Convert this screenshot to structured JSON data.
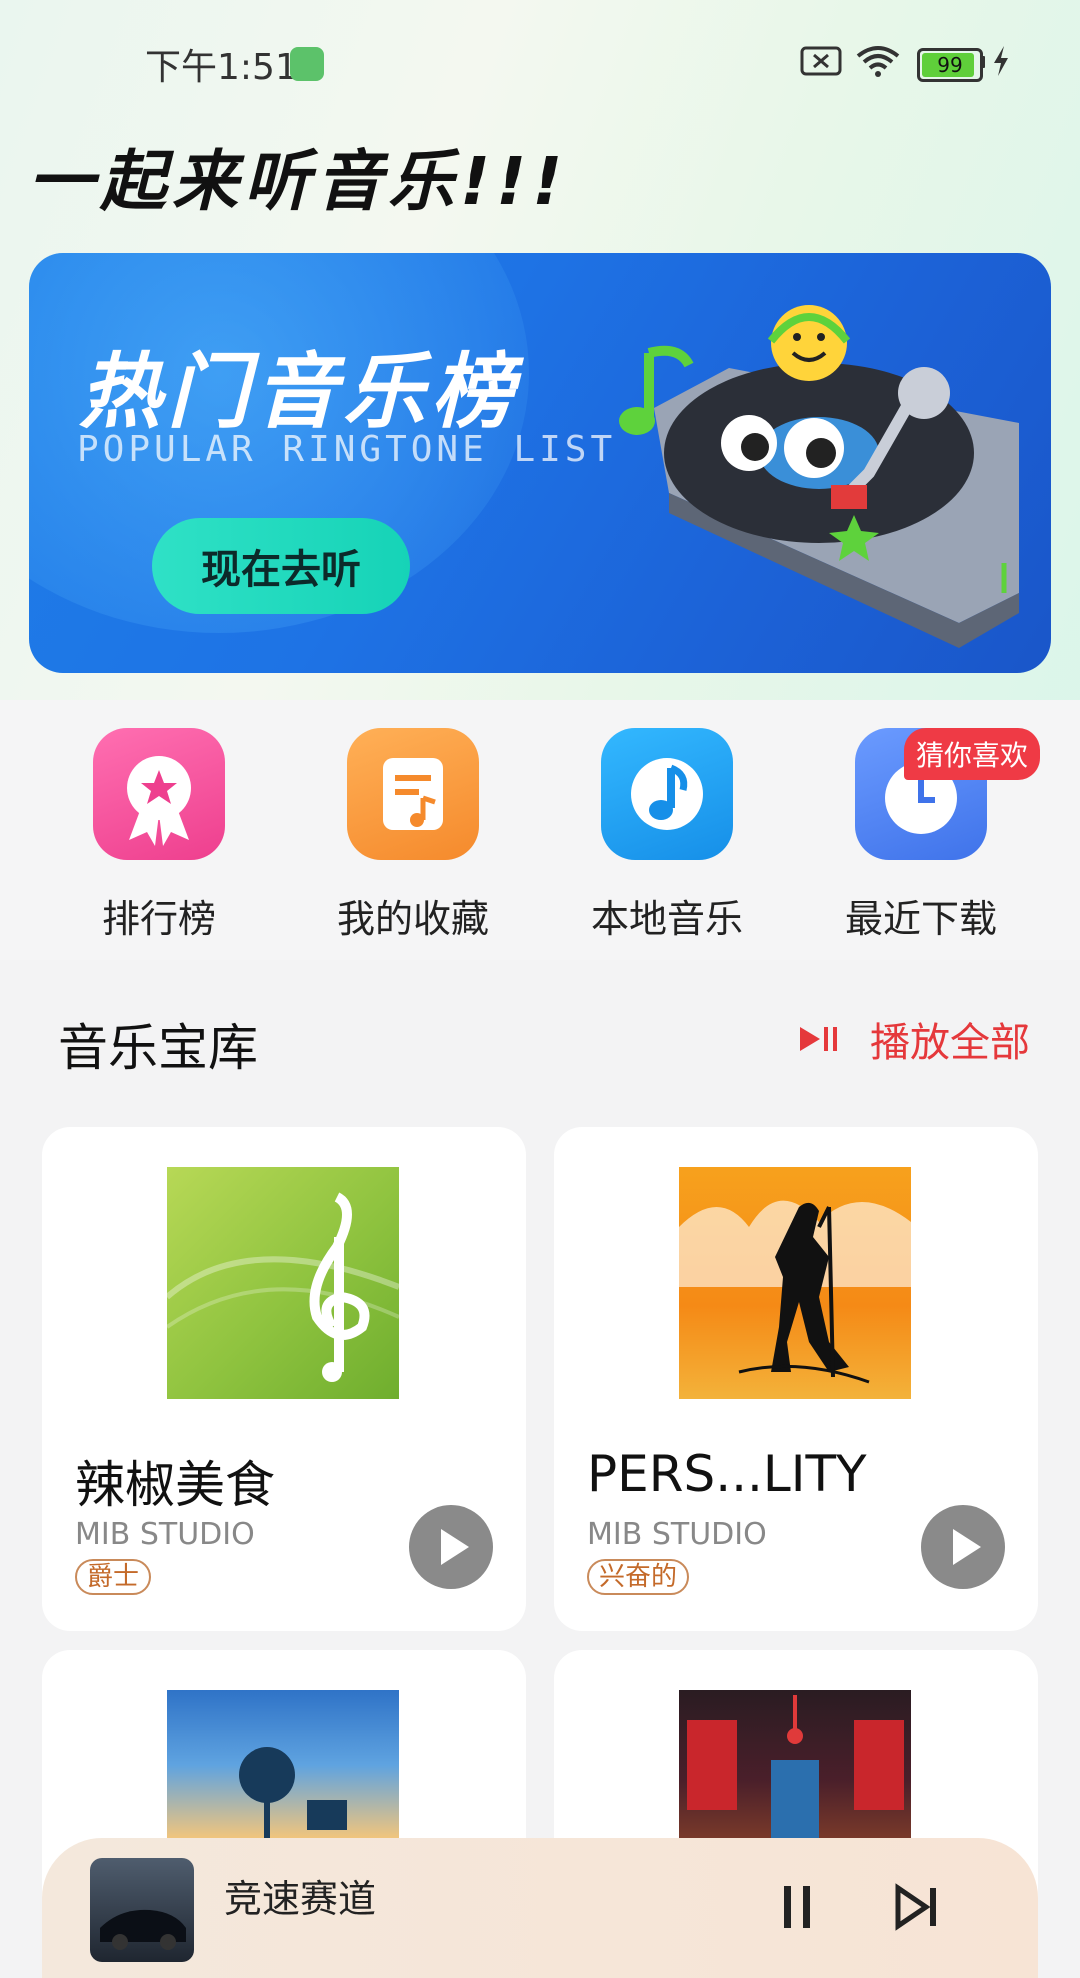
{
  "status": {
    "time": "下午1:51",
    "battery": "99"
  },
  "header": {
    "title": "一起来听音乐!!!"
  },
  "banner": {
    "title": "热门音乐榜",
    "subtitle": "POPULAR RINGTONE LIST",
    "button": "现在去听"
  },
  "quick_actions": [
    {
      "label": "排行榜",
      "icon": "award-icon",
      "color": "#f2549c"
    },
    {
      "label": "我的收藏",
      "icon": "music-note-doc-icon",
      "color": "#f79a3c"
    },
    {
      "label": "本地音乐",
      "icon": "music-note-icon",
      "color": "#1ea3f0"
    },
    {
      "label": "最近下载",
      "icon": "clock-icon",
      "color": "#4c86f0"
    }
  ],
  "badge": "猜你喜欢",
  "library": {
    "title": "音乐宝库",
    "play_all": "播放全部"
  },
  "cards": [
    {
      "title": "辣椒美食",
      "artist": "MIB STUDIO",
      "tag": "爵士"
    },
    {
      "title": "PERS...LITY",
      "artist": "MIB STUDIO",
      "tag": "兴奋的"
    }
  ],
  "player": {
    "title": "竞速赛道"
  }
}
